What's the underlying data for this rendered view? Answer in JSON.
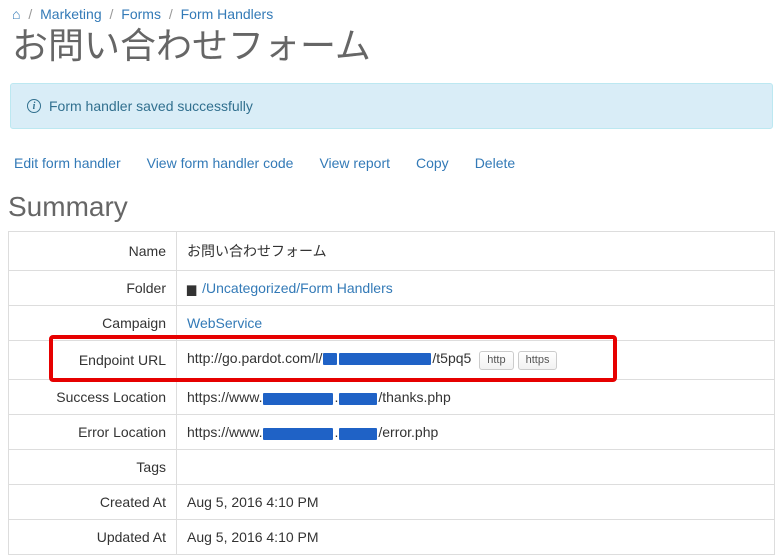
{
  "breadcrumb": {
    "home_aria": "Home",
    "marketing": "Marketing",
    "forms": "Forms",
    "form_handlers": "Form Handlers",
    "sep": "/"
  },
  "page_title": "お問い合わせフォーム",
  "alert": {
    "message": "Form handler saved successfully"
  },
  "actions": {
    "edit": "Edit form handler",
    "view_code": "View form handler code",
    "view_report": "View report",
    "copy": "Copy",
    "delete": "Delete"
  },
  "summary": {
    "heading": "Summary",
    "rows": {
      "name_label": "Name",
      "name_value": "お問い合わせフォーム",
      "folder_label": "Folder",
      "folder_link": "/Uncategorized/Form Handlers",
      "campaign_label": "Campaign",
      "campaign_link": "WebService",
      "endpoint_label": "Endpoint URL",
      "endpoint_prefix": "http://go.pardot.com/l/",
      "endpoint_suffix": "/t5pq5",
      "btn_http": "http",
      "btn_https": "https",
      "success_label": "Success Location",
      "success_prefix": "https://www.",
      "success_suffix": "/thanks.php",
      "error_label": "Error Location",
      "error_prefix": "https://www.",
      "error_suffix": "/error.php",
      "tags_label": "Tags",
      "tags_value": "",
      "created_label": "Created At",
      "created_value": "Aug 5, 2016 4:10 PM",
      "updated_label": "Updated At",
      "updated_value": "Aug 5, 2016 4:10 PM"
    }
  }
}
